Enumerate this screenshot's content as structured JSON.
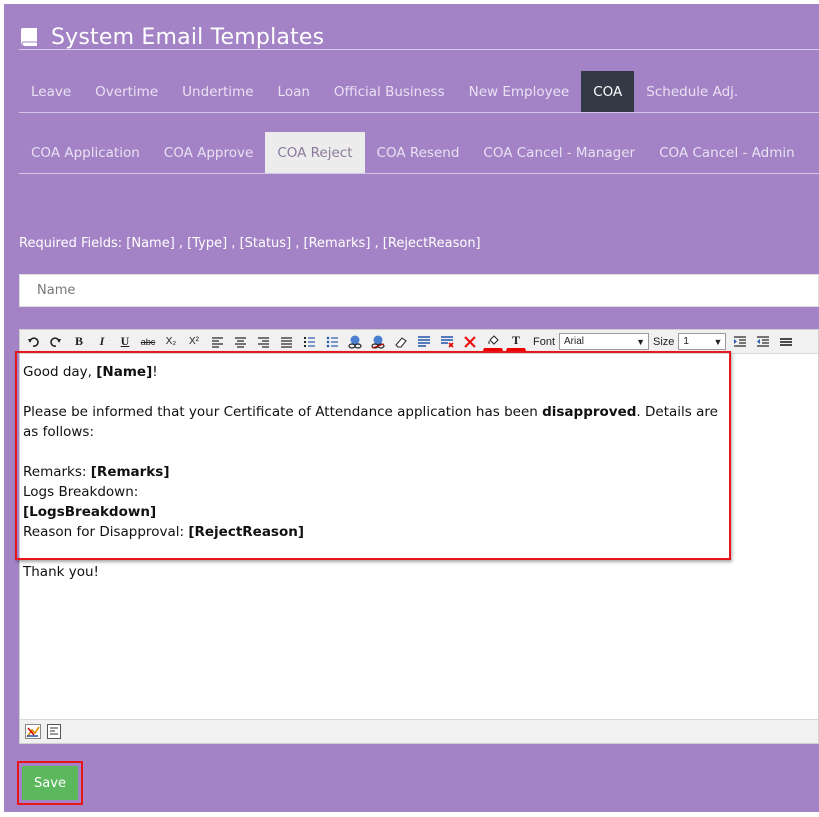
{
  "header": {
    "title": "System Email Templates",
    "icon": "book-icon"
  },
  "main_tabs": [
    {
      "label": "Leave",
      "active": false
    },
    {
      "label": "Overtime",
      "active": false
    },
    {
      "label": "Undertime",
      "active": false
    },
    {
      "label": "Loan",
      "active": false
    },
    {
      "label": "Official Business",
      "active": false
    },
    {
      "label": "New Employee",
      "active": false
    },
    {
      "label": "COA",
      "active": true
    },
    {
      "label": "Schedule Adj.",
      "active": false
    }
  ],
  "sub_tabs": [
    {
      "label": "COA Application",
      "active": false
    },
    {
      "label": "COA Approve",
      "active": false
    },
    {
      "label": "COA Reject",
      "active": true
    },
    {
      "label": "COA Resend",
      "active": false
    },
    {
      "label": "COA Cancel - Manager",
      "active": false
    },
    {
      "label": "COA Cancel - Admin",
      "active": false
    }
  ],
  "required_fields": "Required Fields: [Name] , [Type] , [Status] , [Remarks] , [RejectReason]",
  "subject_input": {
    "placeholder": "Name",
    "value": ""
  },
  "toolbar": {
    "font_label": "Font",
    "font_value": "Arial",
    "size_label": "Size",
    "size_value": "1",
    "bold": "B",
    "italic": "I",
    "underline": "U",
    "strike": "abc",
    "subscript": "X₂",
    "superscript": "X²",
    "text_color": "T"
  },
  "email_body": {
    "greeting_prefix": "Good day, ",
    "greeting_name": "[Name]",
    "greeting_suffix": "!",
    "inform_prefix": "Please be informed that your Certificate of Attendance application has been ",
    "inform_bold": "disapproved",
    "inform_suffix": ". Details are as follows:",
    "remarks_label": "Remarks: ",
    "remarks_value": "[Remarks]",
    "logs_label": "Logs Breakdown:",
    "logs_value": "[LogsBreakdown]",
    "reason_label": "Reason for Disapproval: ",
    "reason_value": "[RejectReason]",
    "closing": "Thank you!"
  },
  "colors": {
    "panel": "#a383c5",
    "active_tab": "#333a45",
    "active_subtab": "#ececec",
    "save_button": "#5cb85c",
    "highlight": "#e8161b"
  },
  "save_button": {
    "label": "Save"
  }
}
